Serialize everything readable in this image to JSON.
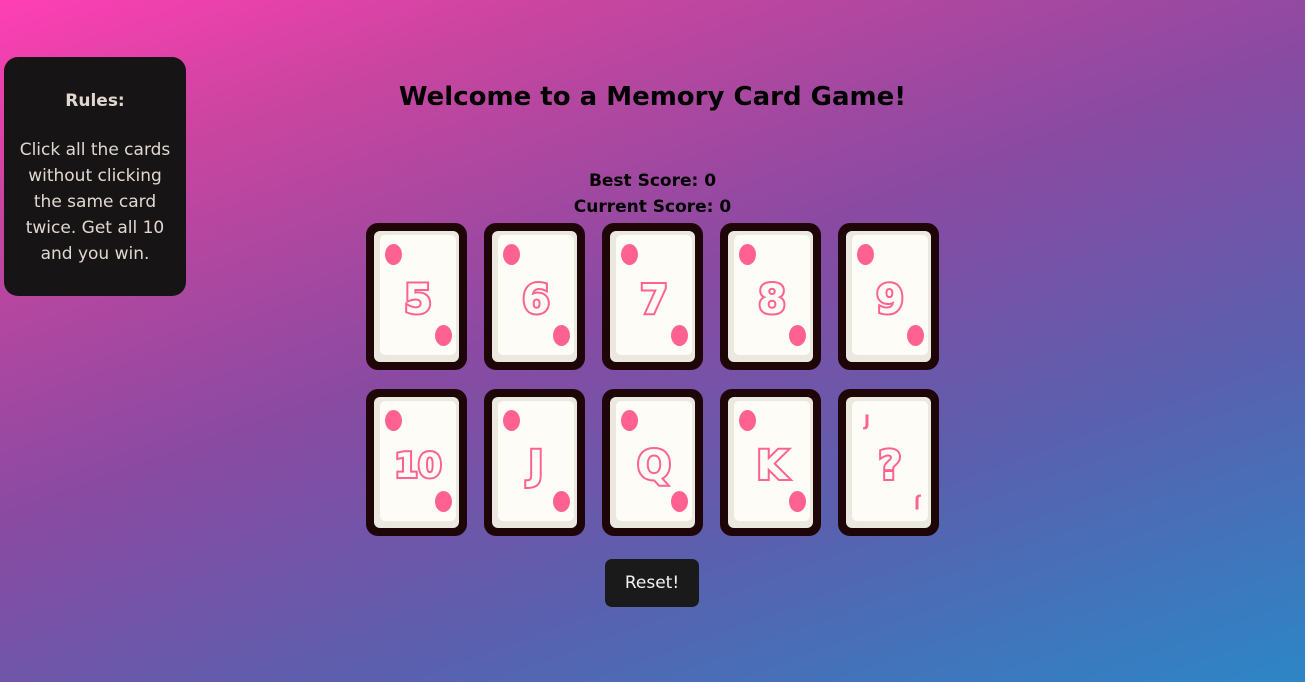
{
  "rules": {
    "title": "Rules:",
    "text": "Click all the cards without clicking the same card twice. Get all 10 and you win."
  },
  "header": {
    "title": "Welcome to a Memory Card Game!"
  },
  "scores": {
    "best": "Best Score: 0",
    "current": "Current Score: 0"
  },
  "cards": [
    {
      "rank": "5"
    },
    {
      "rank": "6"
    },
    {
      "rank": "7"
    },
    {
      "rank": "8"
    },
    {
      "rank": "9"
    },
    {
      "rank": "10"
    },
    {
      "rank": "J"
    },
    {
      "rank": "Q"
    },
    {
      "rank": "K"
    },
    {
      "rank": "?",
      "joker_mark": "J"
    }
  ],
  "controls": {
    "reset_label": "Reset!"
  },
  "colors": {
    "card_border": "#1e0508",
    "card_face": "#fdfcf7",
    "accent_pink": "#ff6291",
    "panel_bg": "#161414",
    "button_bg": "#1a1a1a"
  }
}
